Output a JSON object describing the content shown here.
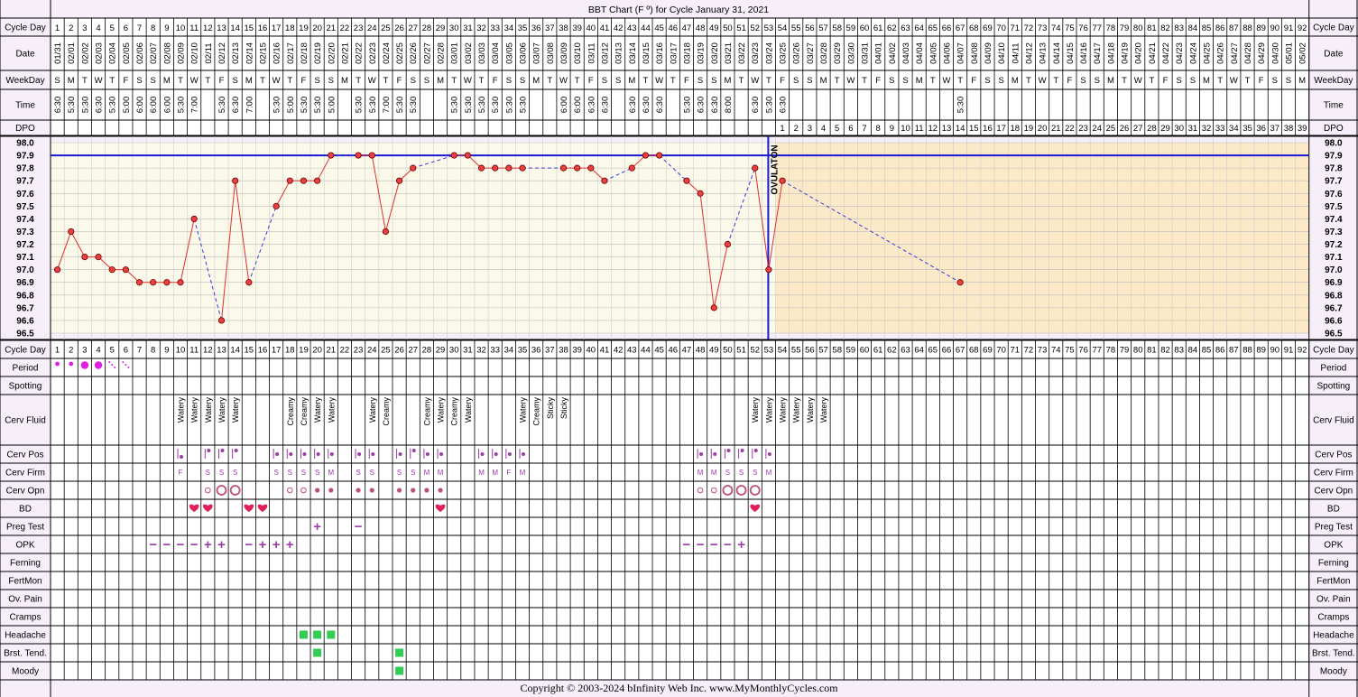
{
  "chart_data": {
    "type": "line",
    "title": "BBT Chart (F º) for Cycle January 31, 2021",
    "days": 92,
    "dates": [
      "01/31",
      "02/01",
      "02/02",
      "02/03",
      "02/04",
      "02/05",
      "02/06",
      "02/07",
      "02/08",
      "02/09",
      "02/10",
      "02/11",
      "02/12",
      "02/13",
      "02/14",
      "02/15",
      "02/16",
      "02/17",
      "02/18",
      "02/19",
      "02/20",
      "02/21",
      "02/22",
      "02/23",
      "02/24",
      "02/25",
      "02/26",
      "02/27",
      "02/28",
      "03/01",
      "03/02",
      "03/03",
      "03/04",
      "03/05",
      "03/06",
      "03/07",
      "03/08",
      "03/09",
      "03/10",
      "03/11",
      "03/12",
      "03/13",
      "03/14",
      "03/15",
      "03/16",
      "03/17",
      "03/18",
      "03/19",
      "03/20",
      "03/21",
      "03/22",
      "03/23",
      "03/24",
      "03/25",
      "03/26",
      "03/27",
      "03/28",
      "03/29",
      "03/30",
      "03/31",
      "04/01",
      "04/02",
      "04/03",
      "04/04",
      "04/05",
      "04/06",
      "04/07",
      "04/08",
      "04/09",
      "04/10",
      "04/11",
      "04/12",
      "04/13",
      "04/14",
      "04/15",
      "04/16",
      "04/17",
      "04/18",
      "04/19",
      "04/20",
      "04/21",
      "04/22",
      "04/23",
      "04/24",
      "04/25",
      "04/26",
      "04/27",
      "04/28",
      "04/29",
      "04/30",
      "05/01",
      "05/02"
    ],
    "weekdays": [
      "S",
      "M",
      "T",
      "W",
      "T",
      "F",
      "S",
      "S",
      "M",
      "T",
      "W",
      "T",
      "F",
      "S",
      "M",
      "T",
      "W",
      "T",
      "F",
      "S",
      "S",
      "M",
      "T",
      "W",
      "T",
      "F",
      "S",
      "S",
      "M",
      "T",
      "W",
      "T",
      "F",
      "S",
      "S",
      "M",
      "T",
      "W",
      "T",
      "F",
      "S",
      "S",
      "M",
      "T",
      "W",
      "T",
      "F",
      "S",
      "S",
      "M",
      "T",
      "W",
      "T",
      "F",
      "S",
      "S",
      "M",
      "T",
      "W",
      "T",
      "F",
      "S",
      "S",
      "M",
      "T",
      "W",
      "T",
      "F",
      "S",
      "S",
      "M",
      "T",
      "W",
      "T",
      "F",
      "S",
      "S",
      "M",
      "T",
      "W",
      "T",
      "F",
      "S",
      "S",
      "M",
      "T",
      "W",
      "T",
      "F",
      "S",
      "S",
      "M"
    ],
    "times": [
      "6:30",
      "5:30",
      "5:30",
      "6:30",
      "5:30",
      "5:00",
      "6:00",
      "6:00",
      "6:00",
      "5:30",
      "7:00",
      "",
      "5:30",
      "6:30",
      "7:00",
      "",
      "5:30",
      "5:00",
      "5:30",
      "5:30",
      "5:00",
      "",
      "5:30",
      "5:30",
      "7:00",
      "5:30",
      "5:30",
      "",
      "",
      "5:30",
      "5:30",
      "5:30",
      "5:30",
      "5:30",
      "5:30",
      "",
      "",
      "6:00",
      "6:00",
      "6:30",
      "6:30",
      "",
      "6:30",
      "6:30",
      "6:30",
      "",
      "5:30",
      "6:30",
      "6:30",
      "8:00",
      "",
      "6:30",
      "5:30",
      "6:30",
      "",
      "",
      "",
      "",
      "",
      "",
      "",
      "",
      "",
      "",
      "",
      "",
      "5:30",
      "",
      "",
      "",
      "",
      "",
      "",
      "",
      "",
      "",
      "",
      "",
      "",
      "",
      "",
      "",
      "",
      "",
      "",
      "",
      "",
      "",
      "",
      "",
      "",
      ""
    ],
    "dpo_start_day": 54,
    "dpo_count": 39,
    "temps": [
      97.0,
      97.3,
      97.1,
      97.1,
      97.0,
      97.0,
      96.9,
      96.9,
      96.9,
      96.9,
      97.4,
      null,
      96.6,
      97.7,
      96.9,
      null,
      97.5,
      97.7,
      97.7,
      97.7,
      97.9,
      null,
      97.9,
      97.9,
      97.3,
      97.7,
      97.8,
      null,
      null,
      97.9,
      97.9,
      97.8,
      97.8,
      97.8,
      97.8,
      null,
      null,
      97.8,
      97.8,
      97.8,
      97.7,
      null,
      97.8,
      97.9,
      97.9,
      null,
      97.7,
      97.6,
      96.7,
      97.2,
      null,
      97.8,
      97.0,
      97.7,
      null,
      null,
      null,
      null,
      null,
      null,
      null,
      null,
      null,
      null,
      null,
      null,
      96.9,
      null,
      null,
      null,
      null,
      null,
      null,
      null,
      null,
      null,
      null,
      null,
      null,
      null,
      null,
      null,
      null,
      null,
      null,
      null,
      null,
      null,
      null,
      null,
      null,
      null
    ],
    "coverline": 97.9,
    "ovulation_day": 53,
    "ovulation_label": "OVULATON",
    "ylim": [
      96.5,
      98.0
    ],
    "y_ticks": [
      "98.0",
      "97.9",
      "97.8",
      "97.7",
      "97.6",
      "97.5",
      "97.4",
      "97.3",
      "97.2",
      "97.1",
      "97.0",
      "96.9",
      "96.8",
      "96.7",
      "96.6",
      "96.5"
    ],
    "row_labels": {
      "cycle_day": "Cycle Day",
      "date": "Date",
      "weekday": "WeekDay",
      "time": "Time",
      "dpo": "DPO",
      "period": "Period",
      "spotting": "Spotting",
      "cerv_fluid": "Cerv Fluid",
      "cerv_pos": "Cerv Pos",
      "cerv_firm": "Cerv Firm",
      "cerv_opn": "Cerv Opn",
      "bd": "BD",
      "preg_test": "Preg Test",
      "opk": "OPK",
      "ferning": "Ferning",
      "fertmon": "FertMon",
      "ov_pain": "Ov. Pain",
      "cramps": "Cramps",
      "headache": "Headache",
      "brst_tend": "Brst. Tend.",
      "moody": "Moody"
    },
    "period": [
      [
        1,
        "light"
      ],
      [
        2,
        "light"
      ],
      [
        3,
        "heavy"
      ],
      [
        4,
        "heavy"
      ],
      [
        5,
        "spot"
      ],
      [
        6,
        "spot"
      ]
    ],
    "cerv_fluid": [
      [
        10,
        "Watery"
      ],
      [
        11,
        "Watery"
      ],
      [
        12,
        "Watery"
      ],
      [
        13,
        "Watery"
      ],
      [
        14,
        "Watery"
      ],
      [
        18,
        "Creamy"
      ],
      [
        19,
        "Creamy"
      ],
      [
        20,
        "Watery"
      ],
      [
        21,
        "Watery"
      ],
      [
        24,
        "Watery"
      ],
      [
        25,
        "Creamy"
      ],
      [
        28,
        "Creamy"
      ],
      [
        29,
        "Watery"
      ],
      [
        30,
        "Creamy"
      ],
      [
        31,
        "Watery"
      ],
      [
        35,
        "Watery"
      ],
      [
        36,
        "Creamy"
      ],
      [
        37,
        "Sticky"
      ],
      [
        38,
        "Sticky"
      ],
      [
        52,
        "Watery"
      ],
      [
        53,
        "Watery"
      ],
      [
        54,
        "Watery"
      ],
      [
        55,
        "Watery"
      ],
      [
        56,
        "Watery"
      ],
      [
        57,
        "Watery"
      ]
    ],
    "cerv_pos": [
      [
        10,
        "low"
      ],
      [
        12,
        "high"
      ],
      [
        13,
        "high"
      ],
      [
        14,
        "high"
      ],
      [
        17,
        "mid"
      ],
      [
        18,
        "mid"
      ],
      [
        19,
        "mid"
      ],
      [
        20,
        "mid"
      ],
      [
        21,
        "mid"
      ],
      [
        23,
        "mid"
      ],
      [
        24,
        "mid"
      ],
      [
        26,
        "mid"
      ],
      [
        27,
        "high"
      ],
      [
        28,
        "mid"
      ],
      [
        29,
        "mid"
      ],
      [
        32,
        "mid"
      ],
      [
        33,
        "mid"
      ],
      [
        34,
        "mid"
      ],
      [
        35,
        "mid"
      ],
      [
        48,
        "mid"
      ],
      [
        49,
        "mid"
      ],
      [
        50,
        "high"
      ],
      [
        51,
        "high"
      ],
      [
        52,
        "high"
      ],
      [
        53,
        "mid"
      ]
    ],
    "cerv_firm": [
      [
        10,
        "F"
      ],
      [
        12,
        "S"
      ],
      [
        13,
        "S"
      ],
      [
        14,
        "S"
      ],
      [
        17,
        "S"
      ],
      [
        18,
        "S"
      ],
      [
        19,
        "S"
      ],
      [
        20,
        "S"
      ],
      [
        21,
        "M"
      ],
      [
        23,
        "S"
      ],
      [
        24,
        "S"
      ],
      [
        26,
        "S"
      ],
      [
        27,
        "S"
      ],
      [
        28,
        "M"
      ],
      [
        29,
        "M"
      ],
      [
        32,
        "M"
      ],
      [
        33,
        "M"
      ],
      [
        34,
        "F"
      ],
      [
        35,
        "M"
      ],
      [
        48,
        "M"
      ],
      [
        49,
        "M"
      ],
      [
        50,
        "S"
      ],
      [
        51,
        "S"
      ],
      [
        52,
        "S"
      ],
      [
        53,
        "M"
      ]
    ],
    "cerv_opn": [
      [
        12,
        "small"
      ],
      [
        13,
        "big"
      ],
      [
        14,
        "big"
      ],
      [
        18,
        "small"
      ],
      [
        19,
        "small"
      ],
      [
        20,
        "dot"
      ],
      [
        21,
        "dot"
      ],
      [
        23,
        "dot"
      ],
      [
        24,
        "dot"
      ],
      [
        26,
        "dot"
      ],
      [
        27,
        "dot"
      ],
      [
        28,
        "dot"
      ],
      [
        29,
        "dot"
      ],
      [
        48,
        "small"
      ],
      [
        49,
        "small"
      ],
      [
        50,
        "big"
      ],
      [
        51,
        "big"
      ],
      [
        52,
        "big"
      ]
    ],
    "bd": [
      11,
      12,
      15,
      16,
      29,
      52
    ],
    "preg_test": [
      [
        20,
        "+"
      ],
      [
        23,
        "−"
      ]
    ],
    "opk": [
      [
        8,
        "−"
      ],
      [
        9,
        "−"
      ],
      [
        10,
        "−"
      ],
      [
        11,
        "−"
      ],
      [
        12,
        "+"
      ],
      [
        13,
        "+"
      ],
      [
        15,
        "−"
      ],
      [
        16,
        "+"
      ],
      [
        17,
        "+"
      ],
      [
        18,
        "+"
      ],
      [
        47,
        "−"
      ],
      [
        48,
        "−"
      ],
      [
        49,
        "−"
      ],
      [
        50,
        "−"
      ],
      [
        51,
        "+"
      ]
    ],
    "headache": [
      19,
      20,
      21
    ],
    "brst_tend": [
      20,
      26
    ],
    "moody": [
      26
    ]
  },
  "footer": "Copyright © 2003-2024 bInfinity Web Inc.     www.MyMonthlyCycles.com"
}
